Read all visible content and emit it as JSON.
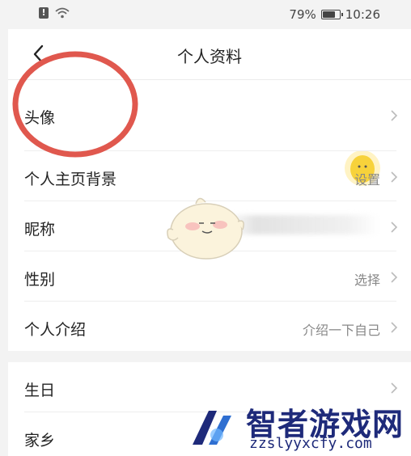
{
  "status_bar": {
    "battery_percent": "79%",
    "time": "10:26"
  },
  "header": {
    "title": "个人资料"
  },
  "rows": [
    {
      "label": "头像",
      "value": ""
    },
    {
      "label": "个人主页背景",
      "value": "设置"
    },
    {
      "label": "昵称",
      "value": ""
    },
    {
      "label": "性别",
      "value": "选择"
    },
    {
      "label": "个人介绍",
      "value": "介绍一下自己"
    },
    {
      "label": "生日",
      "value": ""
    },
    {
      "label": "家乡",
      "value": ""
    }
  ],
  "watermark": {
    "name": "智者游戏网",
    "url": "zzslyyxcfy.com"
  },
  "colors": {
    "annotation_circle": "#e0584e",
    "avatar": "#f7d23b",
    "watermark": "#1e2a7a"
  }
}
